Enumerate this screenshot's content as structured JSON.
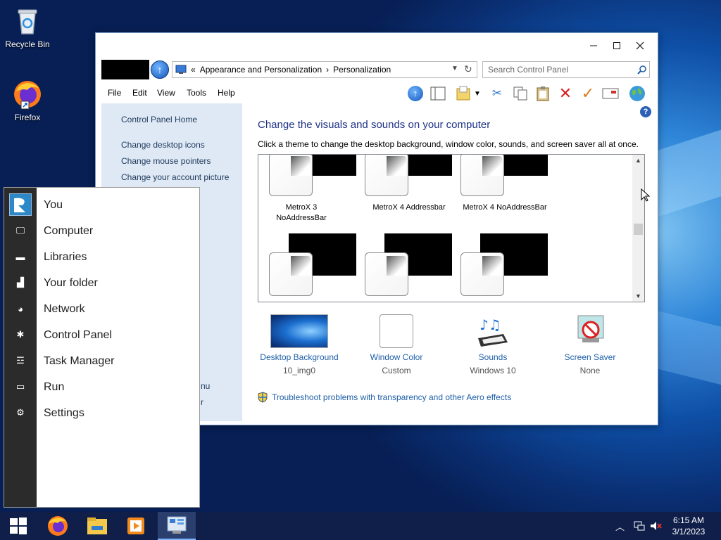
{
  "desktop": {
    "icons": [
      {
        "label": "Recycle Bin"
      },
      {
        "label": "Firefox"
      }
    ]
  },
  "window": {
    "address": {
      "chevron": "«",
      "crumbs": [
        "Appearance and Personalization",
        "Personalization"
      ],
      "separator": "›"
    },
    "search": {
      "placeholder": "Search Control Panel"
    },
    "menu": [
      "File",
      "Edit",
      "View",
      "Tools",
      "Help"
    ],
    "sidebar": {
      "home": "Control Panel Home",
      "links": [
        "Change desktop icons",
        "Change mouse pointers",
        "Change your account picture"
      ],
      "partial_1": "nu",
      "partial_2": "r"
    },
    "main": {
      "heading": "Change the visuals and sounds on your computer",
      "subheading": "Click a theme to change the desktop background, window color, sounds, and screen saver all at once.",
      "themes": [
        {
          "name": "MetroX 3 NoAddressBar"
        },
        {
          "name": "MetroX 4 Addressbar"
        },
        {
          "name": "MetroX 4 NoAddressBar"
        }
      ],
      "bottom": [
        {
          "name": "Desktop Background",
          "value": "10_img0"
        },
        {
          "name": "Window Color",
          "value": "Custom"
        },
        {
          "name": "Sounds",
          "value": "Windows 10"
        },
        {
          "name": "Screen Saver",
          "value": "None"
        }
      ],
      "troubleshoot": "Troubleshoot problems with transparency and other Aero effects"
    }
  },
  "start_menu": {
    "items": [
      "You",
      "Computer",
      "Libraries",
      "Your folder",
      "Network",
      "Control Panel",
      "Task Manager",
      "Run",
      "Settings"
    ]
  },
  "taskbar": {
    "time": "6:15 AM",
    "date": "3/1/2023"
  }
}
